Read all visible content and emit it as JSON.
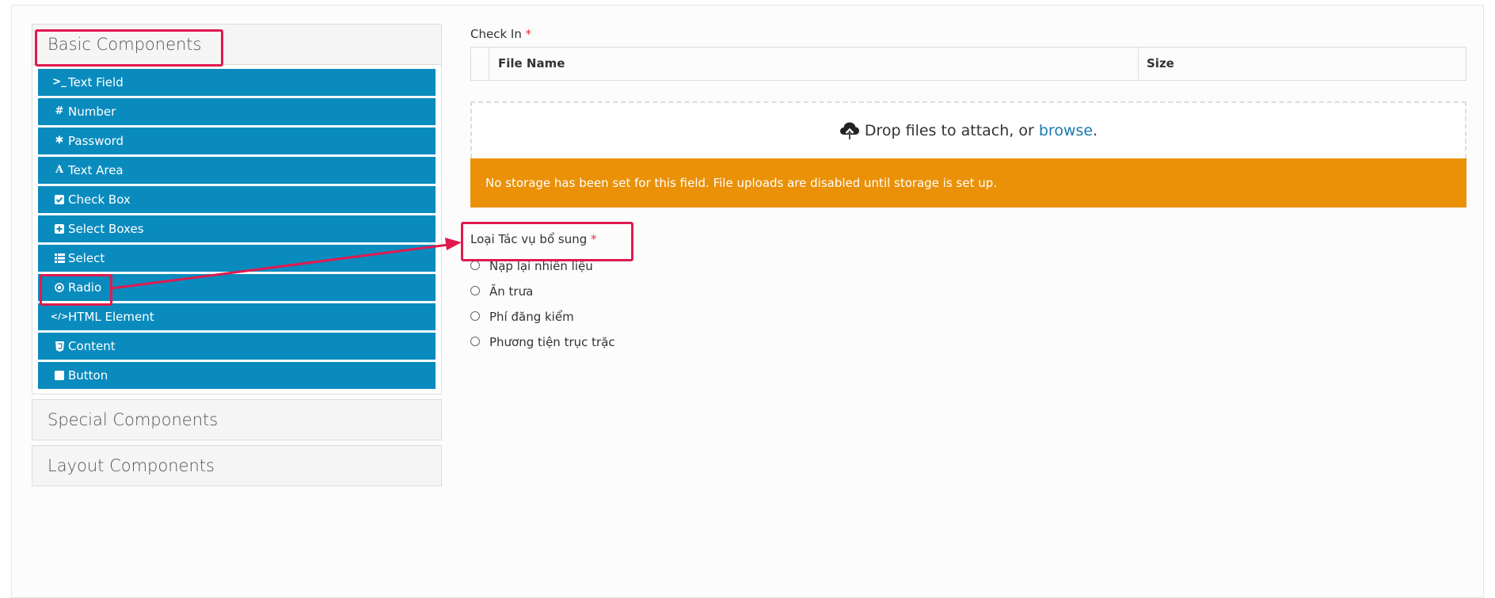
{
  "sidebar": {
    "basic_title": "Basic Components",
    "components": [
      {
        "label": "Text Field",
        "icon": "terminal-icon"
      },
      {
        "label": "Number",
        "icon": "hash-icon"
      },
      {
        "label": "Password",
        "icon": "asterisk-icon"
      },
      {
        "label": "Text Area",
        "icon": "font-icon"
      },
      {
        "label": "Check Box",
        "icon": "check-square-icon"
      },
      {
        "label": "Select Boxes",
        "icon": "plus-square-icon"
      },
      {
        "label": "Select",
        "icon": "list-icon"
      },
      {
        "label": "Radio",
        "icon": "dot-circle-icon"
      },
      {
        "label": "HTML Element",
        "icon": "code-icon"
      },
      {
        "label": "Content",
        "icon": "html5-icon"
      },
      {
        "label": "Button",
        "icon": "square-icon"
      }
    ],
    "special_title": "Special Components",
    "layout_title": "Layout Components"
  },
  "form": {
    "checkin_label": "Check In",
    "required_marker": "*",
    "table_headers": [
      "File Name",
      "Size"
    ],
    "drop_text": "Drop files to attach, or",
    "browse_text": "browse",
    "drop_suffix": ".",
    "storage_alert": "No storage has been set for this field. File uploads are disabled until storage is set up.",
    "radio_label": "Loại Tác vụ bổ sung",
    "radio_options": [
      "Nạp lại nhiên liệu",
      "Ăn trưa",
      "Phí đăng kiểm",
      "Phương tiện trục trặc"
    ]
  },
  "colors": {
    "component_button": "#0a8bbe",
    "alert_bg": "#ea9108",
    "annotation": "#e01a4f",
    "required": "#e0333a",
    "link": "#1a7ab0"
  }
}
